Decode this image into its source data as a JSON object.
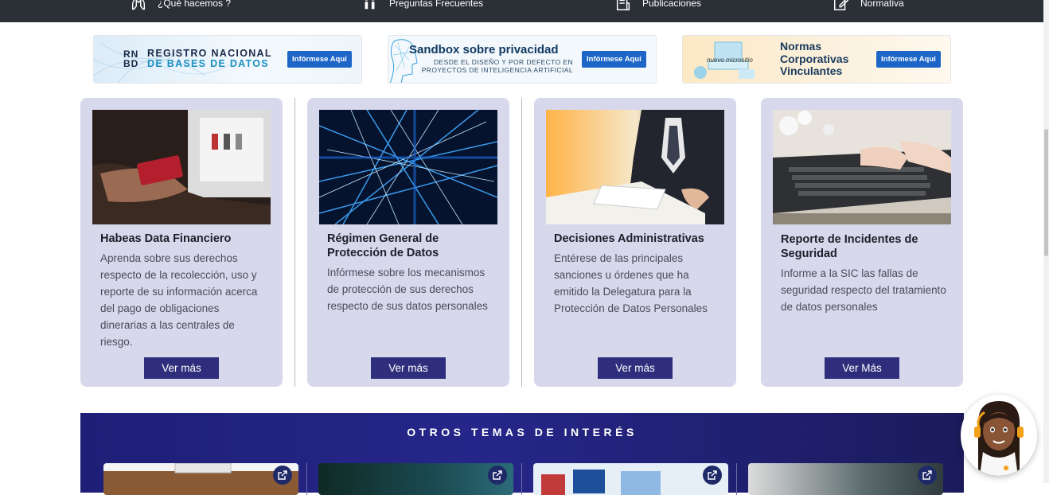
{
  "nav": {
    "items": [
      {
        "label": "¿Qué hacemos ?",
        "icon": "hands-icon"
      },
      {
        "label": "Preguntas Frecuentes",
        "icon": "people-icon"
      },
      {
        "label": "Publicaciones",
        "icon": "document-icon"
      },
      {
        "label": "Normativa",
        "icon": "edit-icon"
      }
    ]
  },
  "banners": [
    {
      "line1": "REGISTRO NACIONAL",
      "line2": "DE BASES DE DATOS",
      "logo": "RN BD",
      "button": "Infórmese Aquí"
    },
    {
      "line1": "Sandbox sobre privacidad",
      "line2": "DESDE EL DISEÑO Y POR DEFECTO EN",
      "line3": "PROYECTOS DE INTELIGENCIA ARTIFICIAL",
      "button": "Infórmese Aquí"
    },
    {
      "tag": "nuevo micrositio",
      "line1": "Normas",
      "line2": "Corporativas",
      "line3": "Vinculantes",
      "button": "Infórmese Aquí"
    }
  ],
  "cards": [
    {
      "title": "Habeas Data Financiero",
      "text": "Aprenda sobre sus derechos respecto de la recolección, uso y reporte de su información acerca del pago de obligaciones dinerarias a las centrales de riesgo.",
      "button": "Ver más"
    },
    {
      "title": "Régimen General de Protección de Datos",
      "text": "Infórmese sobre los mecanismos de protección de sus derechos respecto de sus datos personales",
      "button": "Ver más"
    },
    {
      "title": "Decisiones Administrativas",
      "text": "Entérese de las principales sanciones u órdenes que ha emitido la Delegatura para la Protección de Datos Personales",
      "button": "Ver más"
    },
    {
      "title": "Reporte de Incidentes de Seguridad",
      "text": "Informe a la SIC las fallas de seguridad respecto del tratamiento de datos personales",
      "button": "Ver Más"
    }
  ],
  "otros": {
    "title": "OTROS TEMAS DE INTERÉS"
  },
  "colors": {
    "accent": "#2e2e7c",
    "card_bg": "#d8d8ec",
    "nav_bg": "#2b2f36",
    "banner_button": "#1d66c7"
  }
}
